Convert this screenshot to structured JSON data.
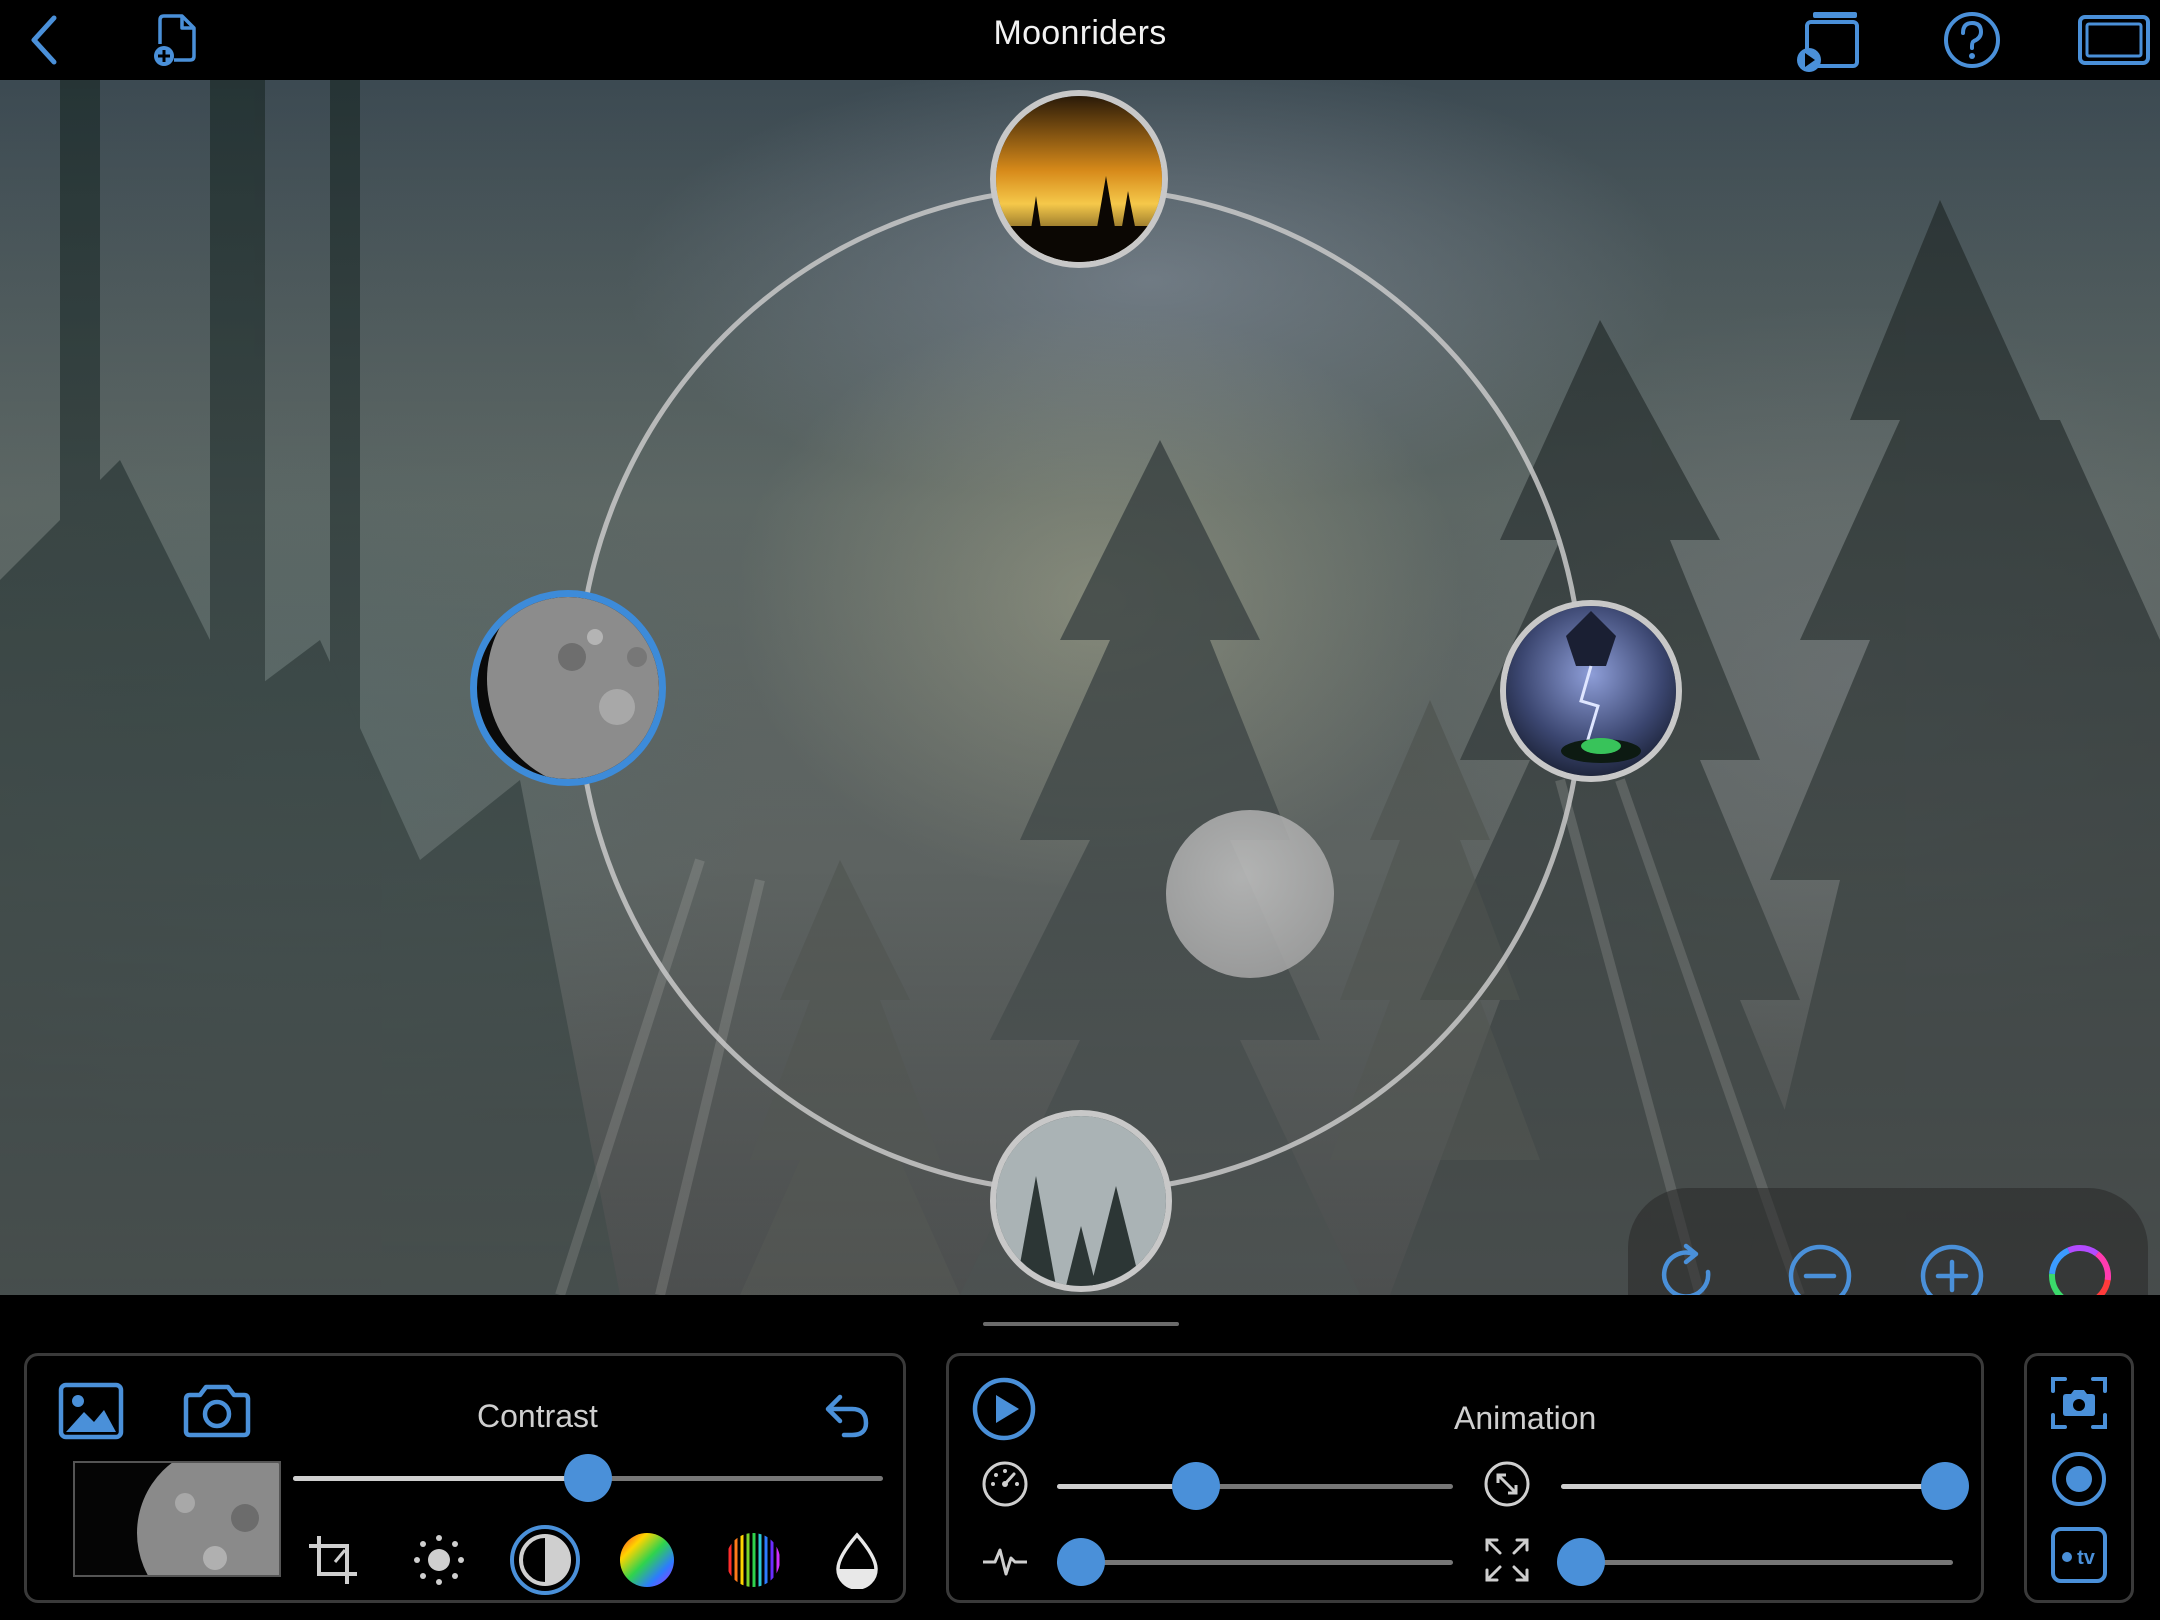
{
  "header": {
    "title": "Moonriders",
    "back_icon": "chevron-left-icon",
    "new_document_icon": "new-document-icon",
    "airplay_icon": "airplay-video-icon",
    "help_icon": "help-icon",
    "display_icon": "display-mode-icon"
  },
  "canvas": {
    "nodes": [
      {
        "name": "sunset-trees",
        "selected": false
      },
      {
        "name": "moon",
        "selected": true
      },
      {
        "name": "lightning-rider",
        "selected": false
      },
      {
        "name": "misty-forest",
        "selected": false
      }
    ],
    "floating_tools": [
      "rotate-icon",
      "zoom-out-icon",
      "zoom-in-icon",
      "color-ring-icon"
    ]
  },
  "adjust_panel": {
    "title": "Contrast",
    "undo_icon": "undo-icon",
    "photo_library_icon": "photo-library-icon",
    "camera_icon": "camera-icon",
    "slider_value": 0.5,
    "tools": [
      "crop-icon",
      "brightness-icon",
      "contrast-icon",
      "hue-icon",
      "spectrum-icon",
      "opacity-drop-icon"
    ],
    "selected_tool": "contrast-icon"
  },
  "animation_panel": {
    "title": "Animation",
    "play_icon": "play-icon",
    "sliders": [
      {
        "icon": "speed-icon",
        "value": 0.35
      },
      {
        "icon": "scale-arrows-icon",
        "value": 0.98
      },
      {
        "icon": "pulse-icon",
        "value": 0.06
      },
      {
        "icon": "expand-icon",
        "value": 0.05
      }
    ]
  },
  "side_panel": {
    "buttons": [
      "screenshot-icon",
      "record-icon",
      "apple-tv-icon"
    ],
    "tv_label": "tv"
  },
  "colors": {
    "accent": "#4a90d9",
    "background": "#000000",
    "panel_border": "#3a3a3a"
  }
}
